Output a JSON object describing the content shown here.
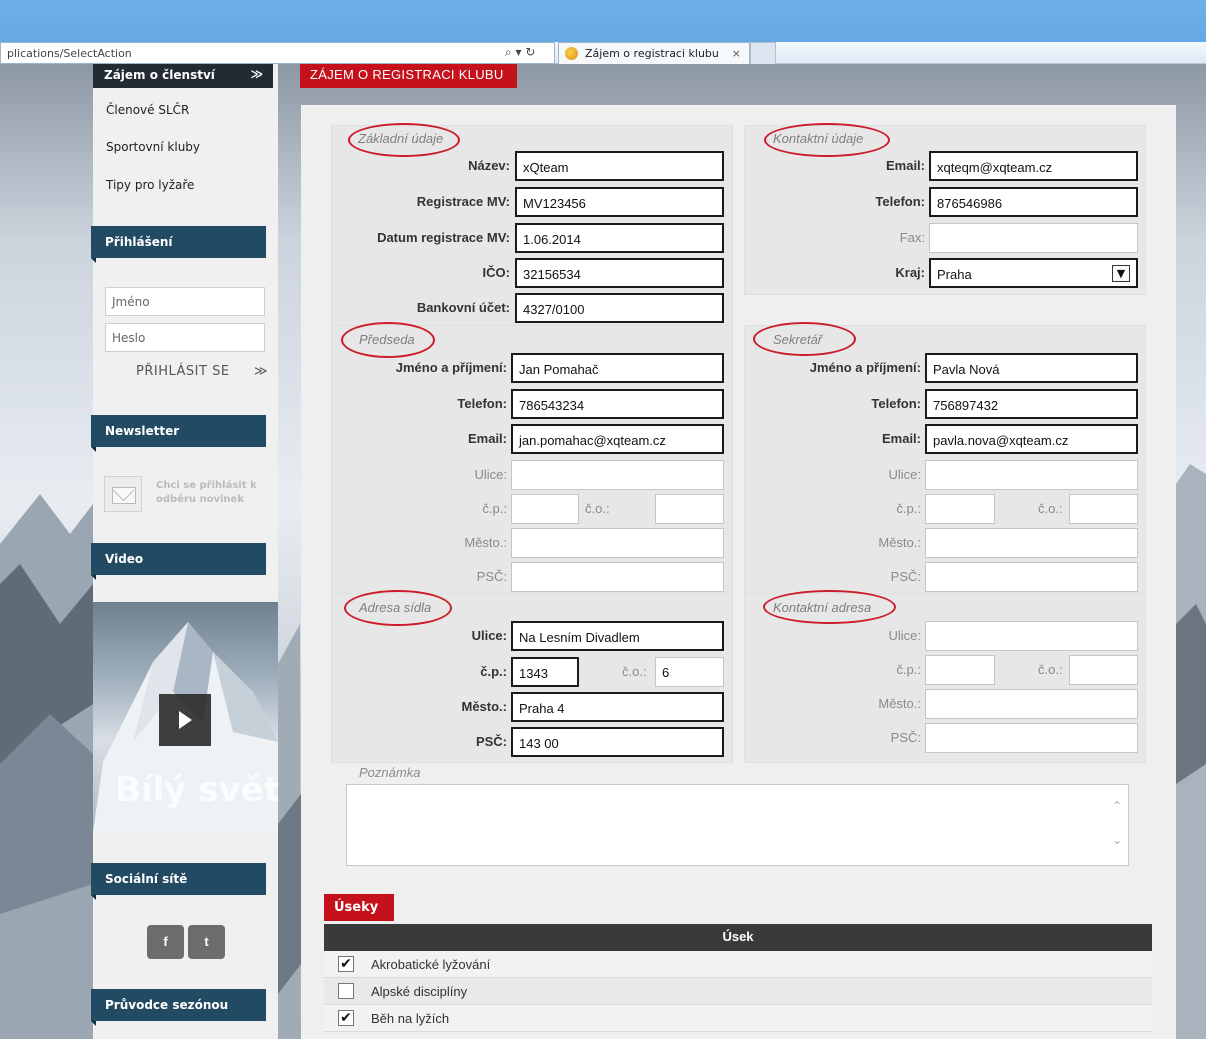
{
  "browser": {
    "url": "plications/SelectAction",
    "url_icons": "⌕ ▾ ↻",
    "tab_title": "Zájem o registraci klubu",
    "tab_close": "×"
  },
  "sidebar": {
    "top_heading": "Zájem o členství",
    "top_chevron": "≫",
    "links": [
      "Členové SLČR",
      "Sportovní kluby",
      "Tipy pro lyžaře"
    ],
    "login": {
      "heading": "Přihlášení",
      "username_placeholder": "Jméno",
      "password_placeholder": "Heslo",
      "button": "PŘIHLÁSIT SE",
      "button_arrow": "≫"
    },
    "newsletter": {
      "heading": "Newsletter",
      "text": "Chci se přihlásit k odběru novinek"
    },
    "video": {
      "heading": "Video",
      "caption": "Bílý svět"
    },
    "social": {
      "heading": "Sociální sítě",
      "facebook": "f",
      "twitter": "t"
    },
    "guide_heading": "Průvodce sezónou"
  },
  "page_tab": "ZÁJEM O REGISTRACI KLUBU",
  "basic": {
    "title": "Základní údaje",
    "name_label": "Název:",
    "name": "xQteam",
    "reg_label": "Registrace MV:",
    "reg": "MV123456",
    "date_label": "Datum registrace MV:",
    "date": "1.06.2014",
    "ico_label": "IČO:",
    "ico": "32156534",
    "bank_label": "Bankovní účet:",
    "bank": "4327/0100"
  },
  "contact": {
    "title": "Kontaktní údaje",
    "email_label": "Email:",
    "email": "xqteqm@xqteam.cz",
    "phone_label": "Telefon:",
    "phone": "876546986",
    "fax_label": "Fax:",
    "fax": "",
    "region_label": "Kraj:",
    "region": "Praha"
  },
  "chairman": {
    "title": "Předseda",
    "name_label": "Jméno a příjmení:",
    "name": "Jan Pomahač",
    "phone_label": "Telefon:",
    "phone": "786543234",
    "email_label": "Email:",
    "email": "jan.pomahac@xqteam.cz",
    "street_label": "Ulice:",
    "street": "",
    "cp_label": "č.p.:",
    "cp": "",
    "co_label": "č.o.:",
    "co": "",
    "city_label": "Město.:",
    "city": "",
    "zip_label": "PSČ:",
    "zip": ""
  },
  "secretary": {
    "title": "Sekretář",
    "name_label": "Jméno a příjmení:",
    "name": "Pavla Nová",
    "phone_label": "Telefon:",
    "phone": "756897432",
    "email_label": "Email:",
    "email": "pavla.nova@xqteam.cz",
    "street_label": "Ulice:",
    "street": "",
    "cp_label": "č.p.:",
    "cp": "",
    "co_label": "č.o.:",
    "co": "",
    "city_label": "Město.:",
    "city": "",
    "zip_label": "PSČ:",
    "zip": ""
  },
  "hq": {
    "title": "Adresa sídla",
    "street_label": "Ulice:",
    "street": "Na Lesním Divadlem",
    "cp_label": "č.p.:",
    "cp": "1343",
    "co_label": "č.o.:",
    "co": "6",
    "city_label": "Město.:",
    "city": "Praha 4",
    "zip_label": "PSČ:",
    "zip": "143 00"
  },
  "contact_address": {
    "title": "Kontaktní adresa",
    "street_label": "Ulice:",
    "street": "",
    "cp_label": "č.p.:",
    "cp": "",
    "co_label": "č.o.:",
    "co": "",
    "city_label": "Město.:",
    "city": "",
    "zip_label": "PSČ:",
    "zip": ""
  },
  "note": {
    "label": "Poznámka",
    "value": "",
    "scroll_up": "⌃",
    "scroll_down": "⌄"
  },
  "sections": {
    "tab": "Úseky",
    "column": "Úsek",
    "rows": [
      {
        "label": "Akrobatické lyžování",
        "check": "✔"
      },
      {
        "label": "Alpské disciplíny",
        "check": ""
      },
      {
        "label": "Běh na lyžích",
        "check": "✔"
      }
    ]
  },
  "colors": {
    "brand_red": "#c5111c",
    "sidebar_heading": "#234a63",
    "annotation_ring": "#cc1c2a"
  }
}
